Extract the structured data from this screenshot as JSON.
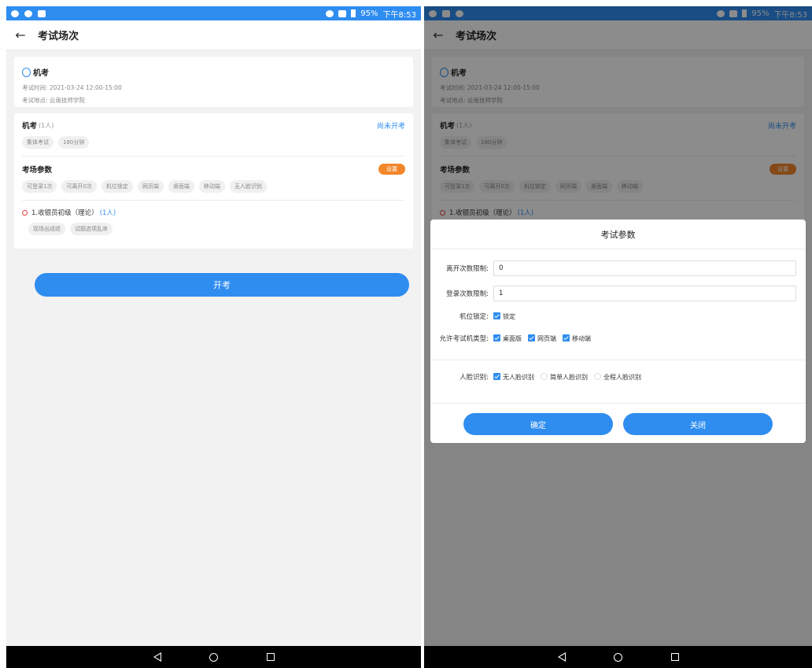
{
  "status": {
    "battery": "95%",
    "time": "下午8:53"
  },
  "header": {
    "title": "考试场次",
    "back_icon": "arrow-left-icon"
  },
  "exam": {
    "name": "机考",
    "time": "考试时间: 2021-03-24 12:00-15:00",
    "place": "考试地点: 云南技师学院"
  },
  "session": {
    "title": "机考",
    "count": "(1人)",
    "status": "尚未开考",
    "tags": [
      "集体考试",
      "180分钟"
    ]
  },
  "params": {
    "title": "考场参数",
    "setting_label": "设置",
    "tags": [
      "可登录1次",
      "可离开0次",
      "机位锁定",
      "网页端",
      "桌面端",
      "移动端",
      "无人脸识别"
    ]
  },
  "subject": {
    "name": "1.收银员初级（理论）",
    "count": "(1人)",
    "tags": [
      "现场出成绩",
      "试题选项乱序"
    ]
  },
  "start_button": "开考",
  "dialog": {
    "title": "考试参数",
    "leave_label": "离开次数限制:",
    "leave_value": "0",
    "login_label": "登录次数限制:",
    "login_value": "1",
    "lock_label": "机位锁定:",
    "lock_option": "锁定",
    "types_label": "允许考试机类型:",
    "types": [
      "桌面版",
      "网页端",
      "移动端"
    ],
    "face_label": "人脸识别:",
    "face_options": [
      "无人脸识别",
      "简单人脸识别",
      "全程人脸识别"
    ],
    "confirm": "确定",
    "close": "关闭"
  },
  "colors": {
    "primary": "#2f8df0",
    "orange": "#f2862a",
    "red": "#e44444"
  }
}
